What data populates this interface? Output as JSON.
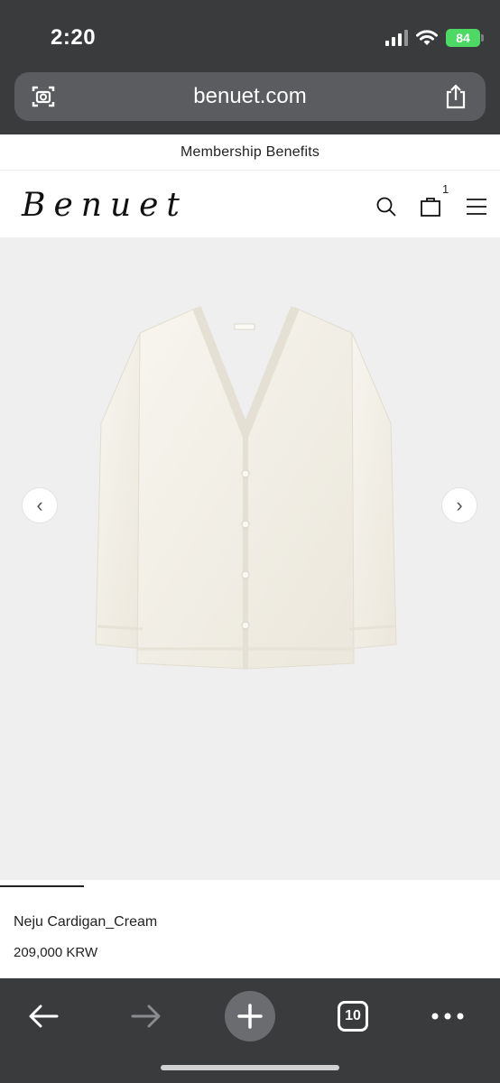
{
  "status_bar": {
    "time": "2:20",
    "battery": "84"
  },
  "browser": {
    "url": "benuet.com",
    "tab_count": "10"
  },
  "site": {
    "banner": "Membership Benefits",
    "logo": "Benuet",
    "cart_count": "1"
  },
  "icons": {
    "url_left": "camera-search-icon",
    "url_right": "share-icon",
    "search": "search-icon",
    "bag": "bag-icon",
    "menu": "hamburger-menu-icon",
    "gallery_prev": "chevron-left-icon",
    "gallery_next": "chevron-right-icon",
    "back": "back-arrow-icon",
    "forward": "forward-arrow-icon",
    "new_tab": "plus-icon",
    "more": "more-dots-icon"
  },
  "product": {
    "name": "Neju Cardigan_Cream",
    "price": "209,000 KRW",
    "image_alt": "cream v-neck knit cardigan"
  },
  "colors": {
    "browser_chrome": "#3a3b3d",
    "url_pill": "#5b5c5f",
    "battery": "#4cd964",
    "gallery_bg": "#efefef",
    "product_cream": "#f4f1e8"
  }
}
